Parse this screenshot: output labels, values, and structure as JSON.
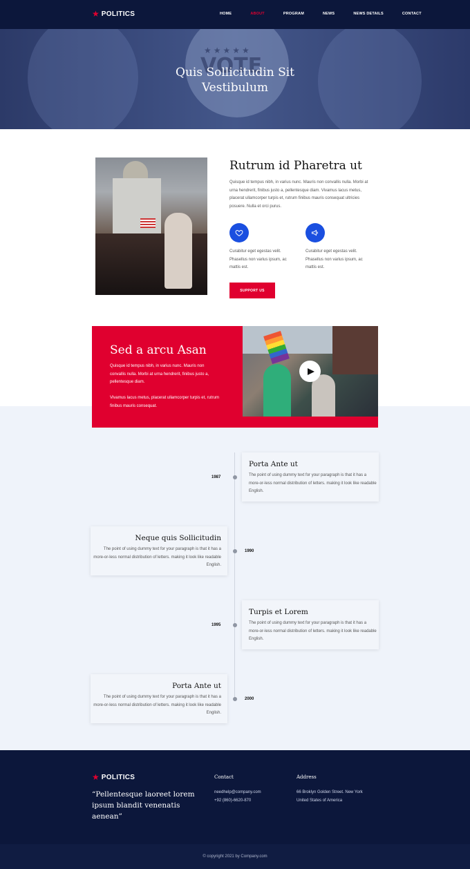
{
  "brand": {
    "name": "POLITICS",
    "accent": "#e0002f",
    "navy": "#0c173b",
    "blue": "#1a4fe0"
  },
  "nav": {
    "items": [
      {
        "label": "HOME"
      },
      {
        "label": "ABOUT"
      },
      {
        "label": "PROGRAM"
      },
      {
        "label": "NEWS"
      },
      {
        "label": "NEWS DETAILS"
      },
      {
        "label": "CONTACT"
      }
    ],
    "active": "ABOUT"
  },
  "hero": {
    "badge_text": "VOTE",
    "title_line1": "Quis Sollicitudin Sit",
    "title_line2": "Vestibulum"
  },
  "about": {
    "title": "Rutrum id Pharetra ut",
    "text": "Quisque id tempus nibh, in varius nunc. Mauris non convallis nulla. Morbi at urna hendrerit, finibus justo a, pellentesque diam. Vivamus lacus metus, placerat ullamcorper turpis et, rutrum finibus mauris consequat ultricies posuere. Nulla et orci purus.",
    "features": [
      {
        "icon": "heart-icon",
        "text": "Curabitur eget egestas velit. Phasellus non varius ipsum, ac mattis est."
      },
      {
        "icon": "megaphone-icon",
        "text": "Curabitur eget egestas velit. Phasellus non varius ipsum, ac mattis est."
      }
    ],
    "button": "SUPPORT US"
  },
  "feature_card": {
    "title": "Sed a arcu Asan",
    "p1": "Quisque id tempus nibh, in varius nunc. Mauris non convallis nulla. Morbi at urna hendrerit, finibus justo a, pellentesque diam.",
    "p2": "Vivamus lacus metus, placerat ullamcorper turpis et, rutrum finibus mauris consequat."
  },
  "timeline": [
    {
      "year": "1987",
      "title": "Porta Ante ut",
      "text": "The point of using dummy text for your paragraph is that it has a more-or-less normal distribution of letters. making it look like readable English."
    },
    {
      "year": "1990",
      "title": "Neque quis Sollicitudin",
      "text": "The point of using dummy text for your paragraph is that it has a more-or-less normal distribution of letters. making it look like readable English."
    },
    {
      "year": "1995",
      "title": "Turpis et Lorem",
      "text": "The point of using dummy text for your paragraph is that it has a more-or-less normal distribution of letters. making it look like readable English."
    },
    {
      "year": "2000",
      "title": "Porta Ante ut",
      "text": "The point of using dummy text for your paragraph is that it has a more-or-less normal distribution of letters. making it look like readable English."
    }
  ],
  "footer": {
    "quote": "“Pellentesque laoreet lorem ipsum blandit venenatis aenean”",
    "contact_title": "Contact",
    "email": "needhelp@company.com",
    "phone": "+92 (860)-6620-870",
    "address_title": "Address",
    "address_line1": "66 Broklyn Golden Street. New York",
    "address_line2": "United States of America",
    "copyright": "© copyright 2021 by Company.com"
  }
}
